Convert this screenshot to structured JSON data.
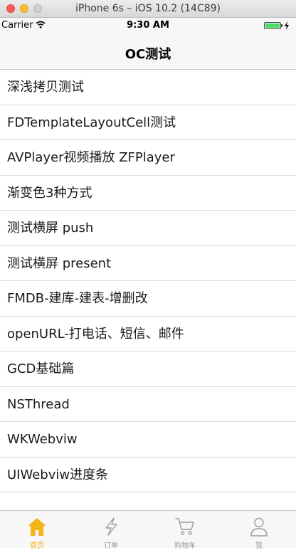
{
  "window": {
    "title": "iPhone 6s – iOS 10.2 (14C89)"
  },
  "status_bar": {
    "carrier": "Carrier",
    "time": "9:30 AM",
    "icons": [
      "wifi-icon",
      "battery-icon",
      "charging-icon"
    ],
    "battery_color": "#4cd964"
  },
  "nav": {
    "title": "OC测试"
  },
  "list": {
    "items": [
      "深浅拷贝测试",
      "FDTemplateLayoutCell测试",
      "AVPlayer视频播放 ZFPlayer",
      "渐变色3种方式",
      "测试横屏 push",
      "测试横屏 present",
      "FMDB-建库-建表-增删改",
      "openURL-打电话、短信、邮件",
      "GCD基础篇",
      "NSThread",
      "WKWebviw",
      "UIWebviw进度条"
    ]
  },
  "tab_bar": {
    "active_color": "#f5b316",
    "inactive_color": "#9b9b9b",
    "tabs": [
      {
        "label": "首页",
        "icon": "home-icon",
        "active": true
      },
      {
        "label": "订单",
        "icon": "lightning-icon",
        "active": false
      },
      {
        "label": "购物车",
        "icon": "cart-icon",
        "active": false
      },
      {
        "label": "我",
        "icon": "person-icon",
        "active": false
      }
    ]
  }
}
